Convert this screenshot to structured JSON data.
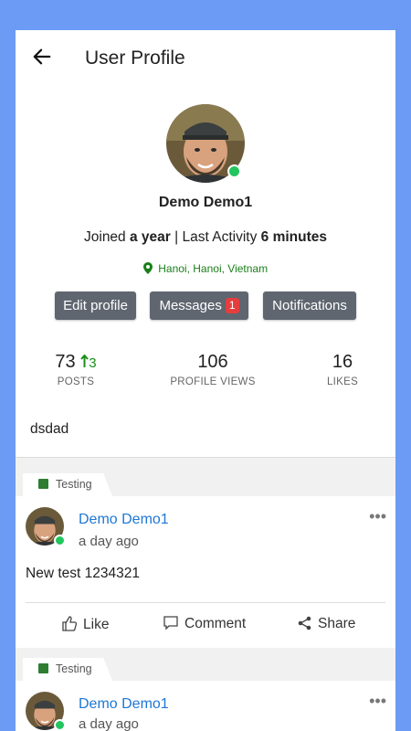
{
  "header": {
    "title": "User Profile"
  },
  "profile": {
    "name": "Demo Demo1",
    "joined_prefix": "Joined",
    "joined_value": "a year",
    "separator": "|",
    "activity_prefix": "Last Activity",
    "activity_value": "6 minutes",
    "location": "Hanoi, Hanoi, Vietnam",
    "bio": "dsdad"
  },
  "actions": {
    "edit_label": "Edit profile",
    "messages_label": "Messages",
    "messages_badge": "1",
    "notifications_label": "Notifications"
  },
  "stats": [
    {
      "value": "73",
      "delta": "3",
      "label": "POSTS"
    },
    {
      "value": "106",
      "label": "PROFILE VIEWS"
    },
    {
      "value": "16",
      "label": "LIKES"
    }
  ],
  "feed": {
    "posts": [
      {
        "tag": "Testing",
        "author": "Demo Demo1",
        "time": "a day ago",
        "text": "New test 1234321",
        "like_label": "Like",
        "comment_label": "Comment",
        "share_label": "Share"
      },
      {
        "tag": "Testing",
        "author": "Demo Demo1",
        "time": "a day ago"
      }
    ]
  },
  "colors": {
    "page_background": "#6b9bf5",
    "button": "#5f6670",
    "badge": "#e53e3e",
    "link": "#1e77d4",
    "online": "#22c55e",
    "location": "#1a7f1a"
  }
}
